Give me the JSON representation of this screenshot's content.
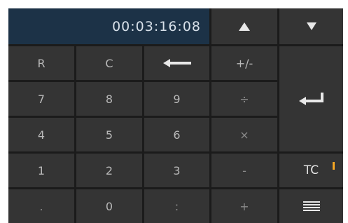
{
  "display": {
    "timecode": "00:03:16:08"
  },
  "nav": {
    "up_icon": "triangle-up-icon",
    "down_icon": "triangle-down-icon"
  },
  "keys": {
    "r": "R",
    "c": "C",
    "backspace_icon": "backspace-arrow-icon",
    "sign": "+/-",
    "k7": "7",
    "k8": "8",
    "k9": "9",
    "divide": "÷",
    "k4": "4",
    "k5": "5",
    "k6": "6",
    "multiply": "×",
    "k1": "1",
    "k2": "2",
    "k3": "3",
    "minus": "-",
    "dot": ".",
    "k0": "0",
    "colon": ":",
    "plus": "+",
    "enter_icon": "enter-return-icon",
    "tc": "TC",
    "menu_icon": "menu-lines-icon"
  },
  "colors": {
    "display_bg": "#1c3247",
    "key_bg": "#343434",
    "indicator": "#f5a623"
  }
}
